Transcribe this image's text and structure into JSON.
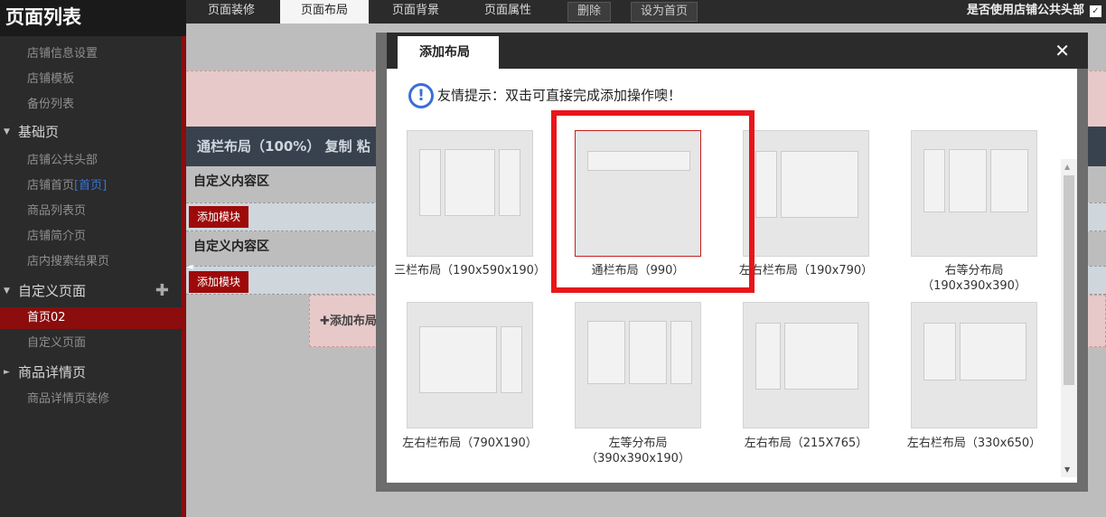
{
  "sidebar": {
    "title": "页面列表",
    "items": [
      {
        "label": "店铺信息设置"
      },
      {
        "label": "店铺模板"
      },
      {
        "label": "备份列表"
      },
      {
        "label": "基础页"
      },
      {
        "label": "店铺公共头部"
      },
      {
        "label": "店铺首页",
        "tag": "[首页]"
      },
      {
        "label": "商品列表页"
      },
      {
        "label": "店铺简介页"
      },
      {
        "label": "店内搜索结果页"
      },
      {
        "label": "自定义页面"
      },
      {
        "label": "首页02"
      },
      {
        "label": "自定义页面"
      },
      {
        "label": "商品详情页"
      },
      {
        "label": "商品详情页装修"
      }
    ]
  },
  "toolbar": {
    "tabs": [
      "页面装修",
      "页面布局",
      "页面背景",
      "页面属性"
    ],
    "delete_label": "删除",
    "set_home_label": "设为首页",
    "header_option": "是否使用店铺公共头部",
    "header_check": "✓"
  },
  "editor": {
    "layout_bar": "通栏布局（100%）  复制  粘",
    "zone_label_1": "自定义内容区",
    "zone_label_2": "自定义内容区",
    "add_module_1": "添加模块",
    "add_module_2": "添加模块",
    "add_layout": "✚添加布局"
  },
  "modal": {
    "title": "添加布局",
    "close": "✕",
    "tip": "友情提示：双击可直接完成添加操作噢！",
    "layouts": [
      {
        "label": "三栏布局（190x590x190）"
      },
      {
        "label": "通栏布局（990）"
      },
      {
        "label": "左右栏布局（190x790）"
      },
      {
        "label": "右等分布局",
        "label2": "（190x390x390）"
      },
      {
        "label": "左右栏布局（790X190）"
      },
      {
        "label": "左等分布局",
        "label2": "（390x390x190）"
      },
      {
        "label": "左右布局（215X765）"
      },
      {
        "label": "左右栏布局（330x650）"
      }
    ]
  },
  "icons": {
    "info": "!",
    "collapse": "◄",
    "scroll_up": "▲",
    "scroll_down": "▼",
    "arrow_down": "▼",
    "arrow_right": "►",
    "plus": "✚"
  },
  "colors": {
    "accent_red": "#8b0d0d",
    "highlight": "#e8161a",
    "tip_blue": "#3b6fd6"
  }
}
